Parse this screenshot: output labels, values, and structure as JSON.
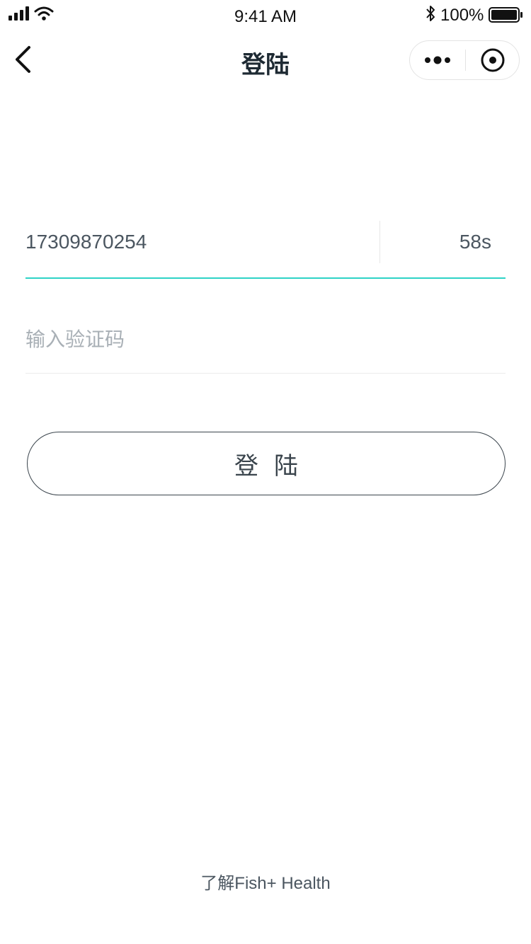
{
  "status_bar": {
    "time": "9:41 AM",
    "battery_percent": "100%"
  },
  "nav": {
    "title": "登陆",
    "icons": {
      "back": "chevron-left-icon",
      "more": "more-dots-icon",
      "close": "target-circle-icon"
    }
  },
  "form": {
    "phone_value": "17309870254",
    "countdown": "58s",
    "code_placeholder": "输入验证码",
    "code_value": "",
    "login_label": "登陆"
  },
  "footer": {
    "link_text": "了解Fish+ Health"
  },
  "colors": {
    "accent": "#2ed3c6",
    "text": "#4b5660",
    "placeholder": "#a9b0b6",
    "button_border": "#3a444c"
  }
}
